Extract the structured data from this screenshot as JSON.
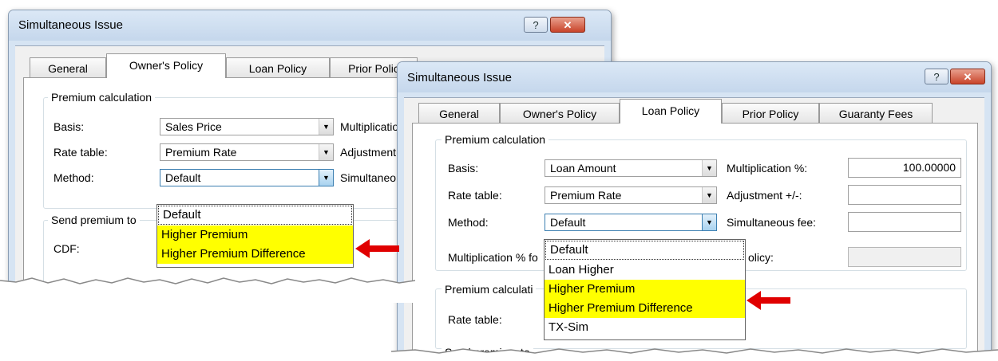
{
  "colors": {
    "highlight": "#ffff00",
    "annotation_arrow": "#e00000",
    "title_bar": "#d6e4f3"
  },
  "back_window": {
    "title": "Simultaneous Issue",
    "help_glyph": "?",
    "close_glyph": "✕",
    "tabs": [
      "General",
      "Owner's Policy",
      "Loan Policy",
      "Prior Polic"
    ],
    "active_tab": "Owner's Policy",
    "premium_group_title": "Premium calculation",
    "basis_label": "Basis:",
    "basis_value": "Sales Price",
    "rate_table_label": "Rate table:",
    "rate_table_value": "Premium Rate",
    "method_label": "Method:",
    "method_value": "Default",
    "mult_label": "Multiplication",
    "adjust_label": "Adjustment",
    "simul_label": "Simultaneo",
    "send_premium_label": "Send premium to",
    "cdf_label": "CDF:",
    "method_options": [
      "Default",
      "Higher Premium",
      "Higher Premium Difference"
    ],
    "highlighted_options": [
      "Higher Premium",
      "Higher Premium Difference"
    ]
  },
  "front_window": {
    "title": "Simultaneous Issue",
    "help_glyph": "?",
    "close_glyph": "✕",
    "tabs": [
      "General",
      "Owner's Policy",
      "Loan Policy",
      "Prior Policy",
      "Guaranty Fees"
    ],
    "active_tab": "Loan Policy",
    "premium_group_title": "Premium calculation",
    "basis_label": "Basis:",
    "basis_value": "Loan Amount",
    "rate_table_label": "Rate table:",
    "rate_table_value": "Premium Rate",
    "method_label": "Method:",
    "method_value": "Default",
    "mult_label": "Multiplication %:",
    "mult_value": "100.00000",
    "adjust_label": "Adjustment +/-:",
    "adjust_value": "",
    "simul_label": "Simultaneous fee:",
    "simul_value": "",
    "mult_for_label": "Multiplication % fo",
    "policy_label": "olicy:",
    "group2_title": "Premium calculati",
    "group2_rate_label": "Rate table:",
    "send_premium_label": "Send premium to",
    "method_options": [
      "Default",
      "Loan Higher",
      "Higher Premium",
      "Higher Premium Difference",
      "TX-Sim"
    ],
    "highlighted_options": [
      "Higher Premium",
      "Higher Premium Difference"
    ]
  }
}
